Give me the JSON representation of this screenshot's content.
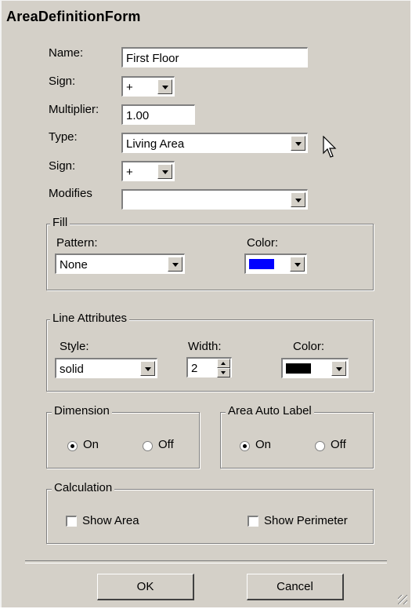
{
  "window": {
    "title": "AreaDefinitionForm"
  },
  "fields": {
    "name": {
      "label": "Name:",
      "value": "First Floor"
    },
    "sign1": {
      "label": "Sign:",
      "value": "+"
    },
    "multiplier": {
      "label": "Multiplier:",
      "value": "1.00"
    },
    "type": {
      "label": "Type:",
      "value": "Living Area"
    },
    "sign2": {
      "label": "Sign:",
      "value": "+"
    },
    "modifies": {
      "label": "Modifies",
      "value": ""
    }
  },
  "fill": {
    "legend": "Fill",
    "pattern_label": "Pattern:",
    "pattern_value": "None",
    "color_label": "Color:",
    "color": "#0000ff"
  },
  "line_attributes": {
    "legend": "Line Attributes",
    "style_label": "Style:",
    "style_value": "solid",
    "width_label": "Width:",
    "width_value": "2",
    "color_label": "Color:",
    "color": "#000000"
  },
  "dimension": {
    "legend": "Dimension",
    "on_label": "On",
    "off_label": "Off",
    "selected": "On"
  },
  "area_auto_label": {
    "legend": "Area Auto Label",
    "on_label": "On",
    "off_label": "Off",
    "selected": "On"
  },
  "calculation": {
    "legend": "Calculation",
    "show_area_label": "Show Area",
    "show_area_checked": false,
    "show_perimeter_label": "Show Perimeter",
    "show_perimeter_checked": false
  },
  "buttons": {
    "ok": "OK",
    "cancel": "Cancel"
  }
}
